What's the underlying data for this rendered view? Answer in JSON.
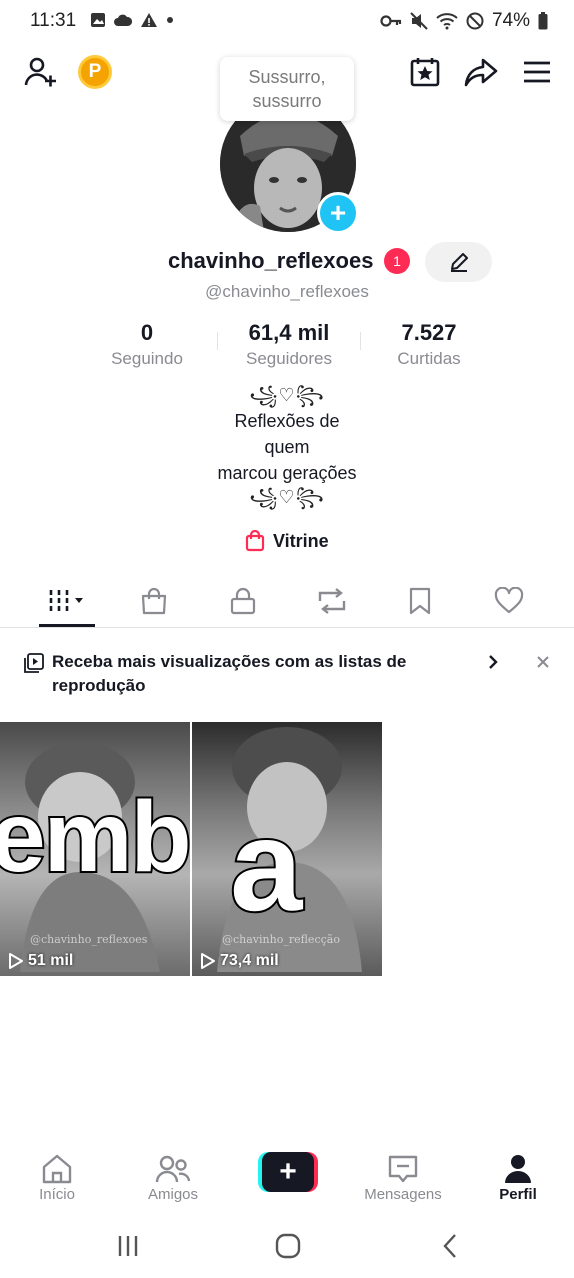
{
  "status_bar": {
    "time": "11:31",
    "battery": "74%"
  },
  "header": {
    "coin_letter": "P"
  },
  "tooltip": {
    "text": "Sussurro, sussurro"
  },
  "profile": {
    "display_name": "chavinho_reflexoes",
    "notification_count": "1",
    "handle": "@chavinho_reflexoes"
  },
  "stats": [
    {
      "value": "0",
      "label": "Seguindo"
    },
    {
      "value": "61,4 mil",
      "label": "Seguidores"
    },
    {
      "value": "7.527",
      "label": "Curtidas"
    }
  ],
  "bio": {
    "ornament_top": "꧁♡꧂",
    "lines": [
      "Reflexões de",
      "quem",
      "marcou gerações"
    ],
    "ornament_bottom": "꧁♡꧂"
  },
  "vitrine_label": "Vitrine",
  "tabs": [
    {
      "name": "videos-tab",
      "icon": "grid-icon"
    },
    {
      "name": "shop-tab",
      "icon": "bag-icon"
    },
    {
      "name": "private-tab",
      "icon": "lock-icon"
    },
    {
      "name": "reposts-tab",
      "icon": "repost-icon"
    },
    {
      "name": "favorites-tab",
      "icon": "bookmark-icon"
    },
    {
      "name": "liked-tab",
      "icon": "heart-icon"
    }
  ],
  "promo": {
    "text": "Receba mais visualizações com as listas de reprodução"
  },
  "videos": [
    {
      "overlay_text": "embr",
      "views": "51 mil",
      "watermark": "@chavinho_reflexoes"
    },
    {
      "overlay_text": "a",
      "views": "73,4 mil",
      "watermark": "@chavinho_reflecção"
    }
  ],
  "bottom_nav": [
    {
      "label": "Início",
      "icon": "home-icon"
    },
    {
      "label": "Amigos",
      "icon": "friends-icon"
    },
    {
      "label": "Mensagens",
      "icon": "inbox-icon"
    },
    {
      "label": "Perfil",
      "icon": "profile-icon"
    }
  ],
  "colors": {
    "accent_red": "#fe2c55",
    "accent_cyan": "#25f4ee",
    "add_blue": "#20c4f4",
    "coin_gold": "#f5a300"
  }
}
